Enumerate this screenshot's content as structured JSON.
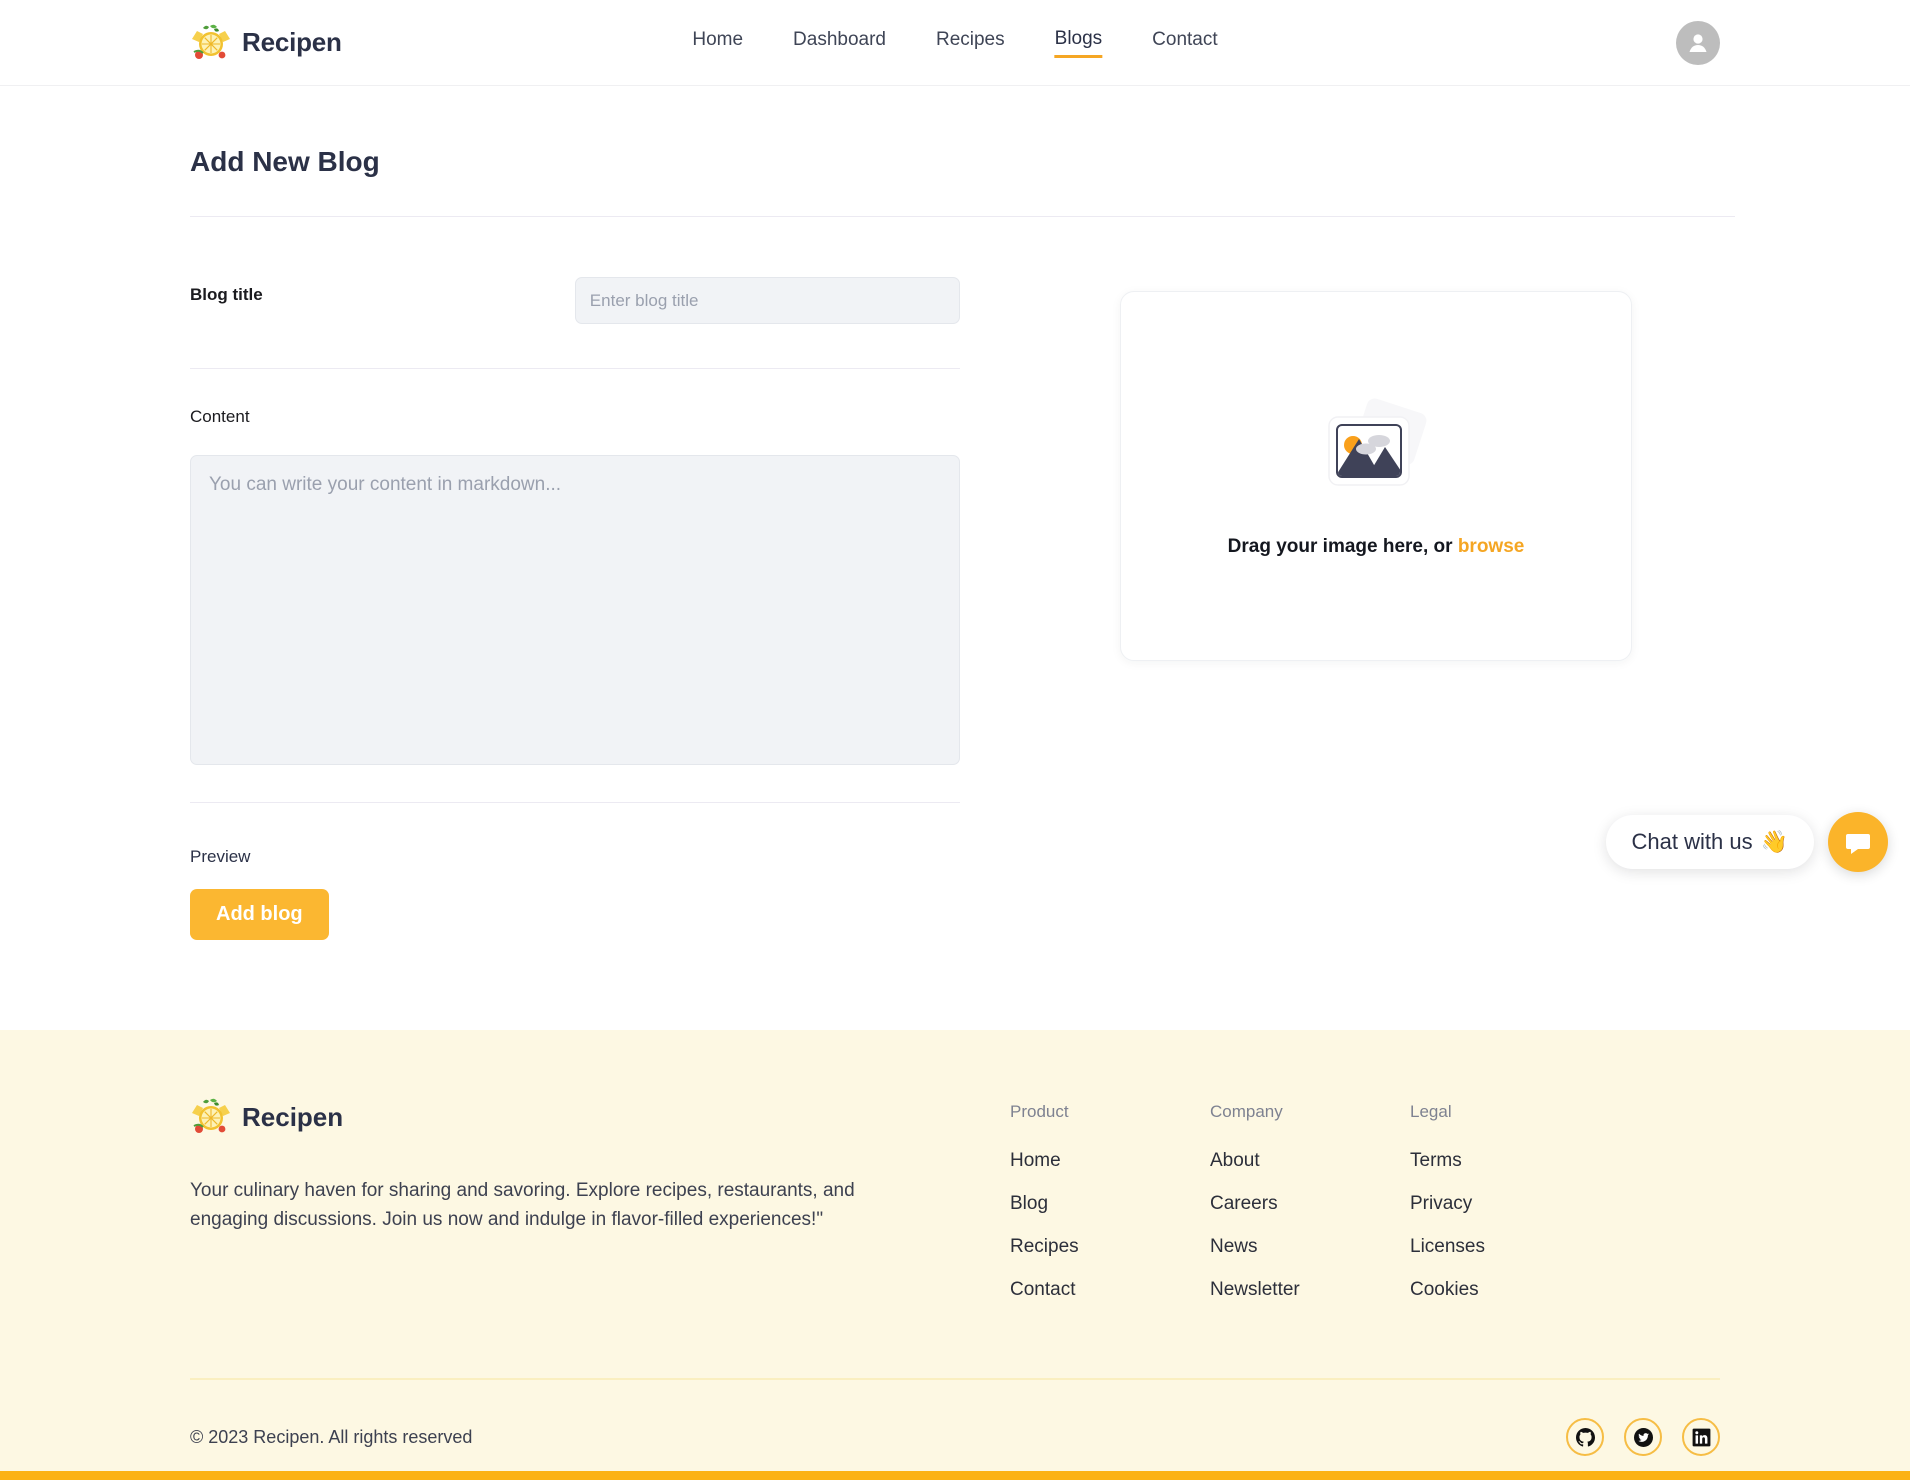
{
  "header": {
    "brand_name": "Recipen",
    "logo_icon": "lemon-citrus-logo",
    "nav": [
      {
        "label": "Home",
        "active": false
      },
      {
        "label": "Dashboard",
        "active": false
      },
      {
        "label": "Recipes",
        "active": false
      },
      {
        "label": "Blogs",
        "active": true
      },
      {
        "label": "Contact",
        "active": false
      }
    ],
    "avatar_icon": "user-avatar-icon"
  },
  "main": {
    "page_title": "Add New Blog",
    "blog_title_label": "Blog title",
    "blog_title_value": "",
    "blog_title_placeholder": "Enter blog title",
    "content_label": "Content",
    "content_value": "",
    "content_placeholder": "You can write your content in markdown...",
    "preview_label": "Preview",
    "submit_label": "Add blog"
  },
  "upload": {
    "icon": "image-placeholder-icon",
    "prompt_text": "Drag your image here, or ",
    "browse_label": "browse"
  },
  "chat": {
    "pill_text": "Chat with us",
    "wave_emoji": "👋",
    "fab_icon": "chat-bubble-icon"
  },
  "footer": {
    "brand_name": "Recipen",
    "logo_icon": "lemon-citrus-logo",
    "description": "Your culinary haven for sharing and savoring. Explore recipes, restaurants, and engaging discussions. Join us now and indulge in flavor-filled experiences!\"",
    "columns": [
      {
        "title": "Product",
        "links": [
          "Home",
          "Blog",
          "Recipes",
          "Contact"
        ]
      },
      {
        "title": "Company",
        "links": [
          "About",
          "Careers",
          "News",
          "Newsletter"
        ]
      },
      {
        "title": "Legal",
        "links": [
          "Terms",
          "Privacy",
          "Licenses",
          "Cookies"
        ]
      }
    ],
    "copyright": "© 2023 Recipen. All rights reserved",
    "socials": [
      {
        "name": "github-icon"
      },
      {
        "name": "twitter-icon"
      },
      {
        "name": "linkedin-icon"
      }
    ]
  },
  "colors": {
    "accent": "#fbb731",
    "accent_link": "#f5a623",
    "dark_navy": "#2b3147",
    "footer_bg": "#fdf8e3",
    "input_bg": "#f1f3f6",
    "bottom_bar": "#fcb215"
  }
}
